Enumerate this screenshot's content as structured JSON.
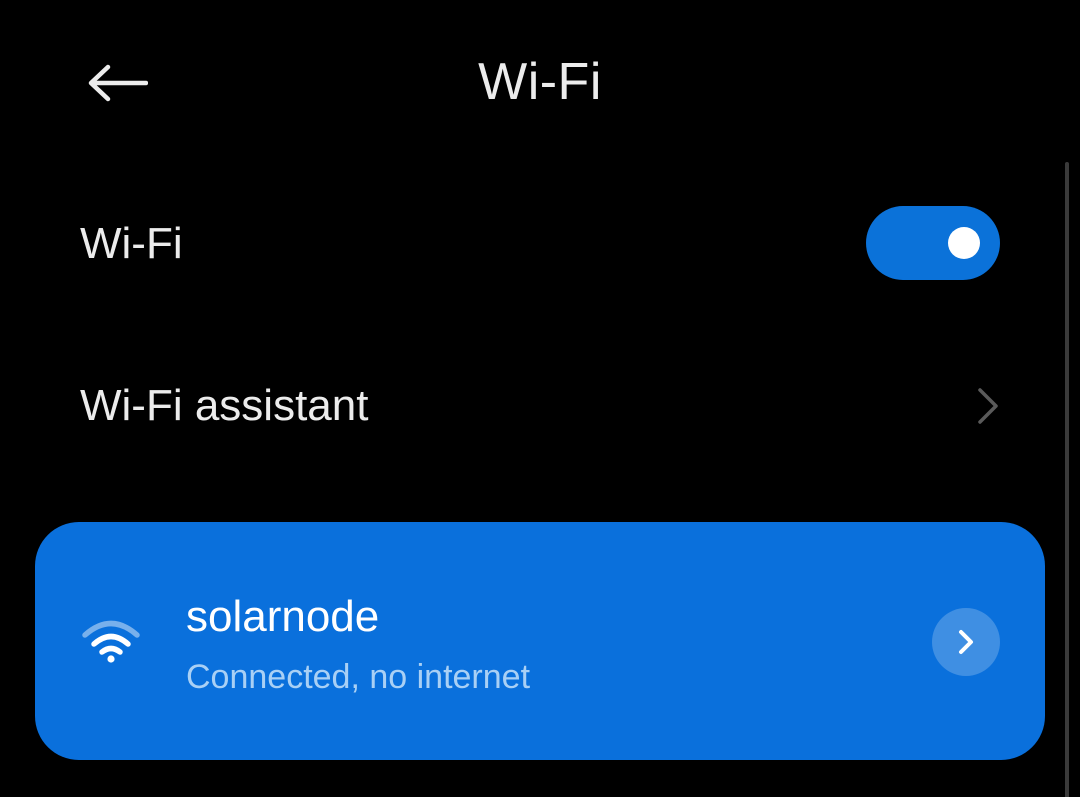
{
  "header": {
    "title": "Wi-Fi",
    "back_icon": "arrow-left-icon"
  },
  "settings": {
    "wifi_toggle": {
      "label": "Wi-Fi",
      "enabled": true
    },
    "wifi_assistant": {
      "label": "Wi-Fi assistant",
      "icon": "chevron-right-icon"
    }
  },
  "connected_network": {
    "name": "solarnode",
    "status": "Connected, no internet",
    "icon": "wifi-icon",
    "details_icon": "chevron-right-icon"
  },
  "colors": {
    "background": "#000000",
    "text_primary": "#ececec",
    "accent": "#0b72d9",
    "card": "#0a70dc",
    "status_text": "#a9d0f5",
    "chevron_muted": "#5a5a5a"
  }
}
